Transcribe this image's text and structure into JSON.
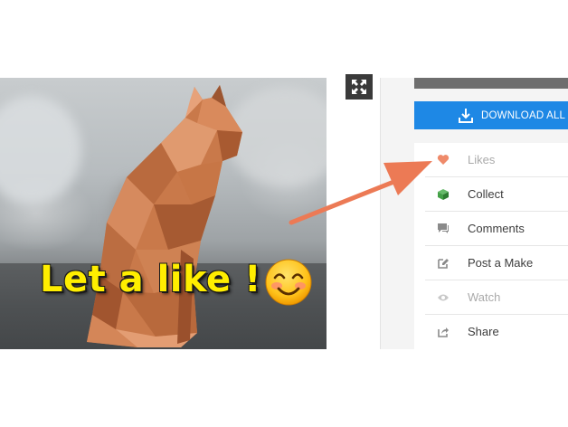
{
  "photo": {
    "caption": "Let a like !",
    "emoji_icon": "smiling-face-emoji"
  },
  "viewer": {
    "expand_icon": "expand-arrows-icon"
  },
  "download": {
    "label": "DOWNLOAD ALL FIL",
    "icon": "download-icon",
    "color": "#1e88e5"
  },
  "actions": [
    {
      "label": "Likes",
      "icon": "heart-icon",
      "enabled": false
    },
    {
      "label": "Collect",
      "icon": "cube-icon",
      "enabled": true
    },
    {
      "label": "Comments",
      "icon": "comment-icon",
      "enabled": true
    },
    {
      "label": "Post a Make",
      "icon": "edit-icon",
      "enabled": true
    },
    {
      "label": "Watch",
      "icon": "eye-icon",
      "enabled": false
    },
    {
      "label": "Share",
      "icon": "share-icon",
      "enabled": true
    }
  ],
  "colors": {
    "arrow": "#ec7a55",
    "caption": "#ffee00",
    "heart": "#ef8a6a",
    "cube": "#43a047"
  }
}
